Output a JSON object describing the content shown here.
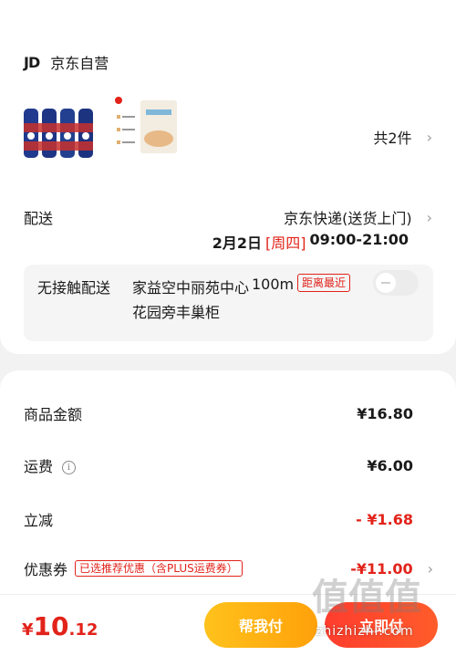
{
  "store": {
    "logo_text": "JD",
    "name": "京东自营"
  },
  "products": {
    "quantity": "共2件"
  },
  "delivery": {
    "label": "配送",
    "method": "京东快递(送货上门)",
    "date": "2月2日",
    "weekday": "[周四]",
    "time_range": "09:00-21:00"
  },
  "contactless": {
    "label": "无接触配送",
    "address": "家益空中丽苑中心花园旁丰巢柜",
    "distance": "100m",
    "tag": "距离最近",
    "enabled": false
  },
  "fees": {
    "goods_label": "商品金额",
    "goods_amount": "¥16.80",
    "shipping_label": "运费",
    "shipping_amount": "¥6.00",
    "discount_label": "立减",
    "discount_amount": "- ¥1.68",
    "coupon_label": "优惠券",
    "coupon_tag": "已选推荐优惠（含PLUS运费券）",
    "coupon_amount": "-¥11.00"
  },
  "footer": {
    "currency": "¥",
    "total_int": "10",
    "total_dec": ".12",
    "help_pay_label": "帮我付",
    "pay_label": "立即付"
  },
  "watermark": {
    "glyphs": "值值值",
    "text": "zhizhizhi.com"
  },
  "colors": {
    "accent_red": "#e2231a",
    "help_pay_yellow": "#ffb313",
    "pay_red": "#ff3d2e"
  },
  "icons": [
    "chevron-right-icon",
    "info-icon",
    "toggle-switch"
  ]
}
